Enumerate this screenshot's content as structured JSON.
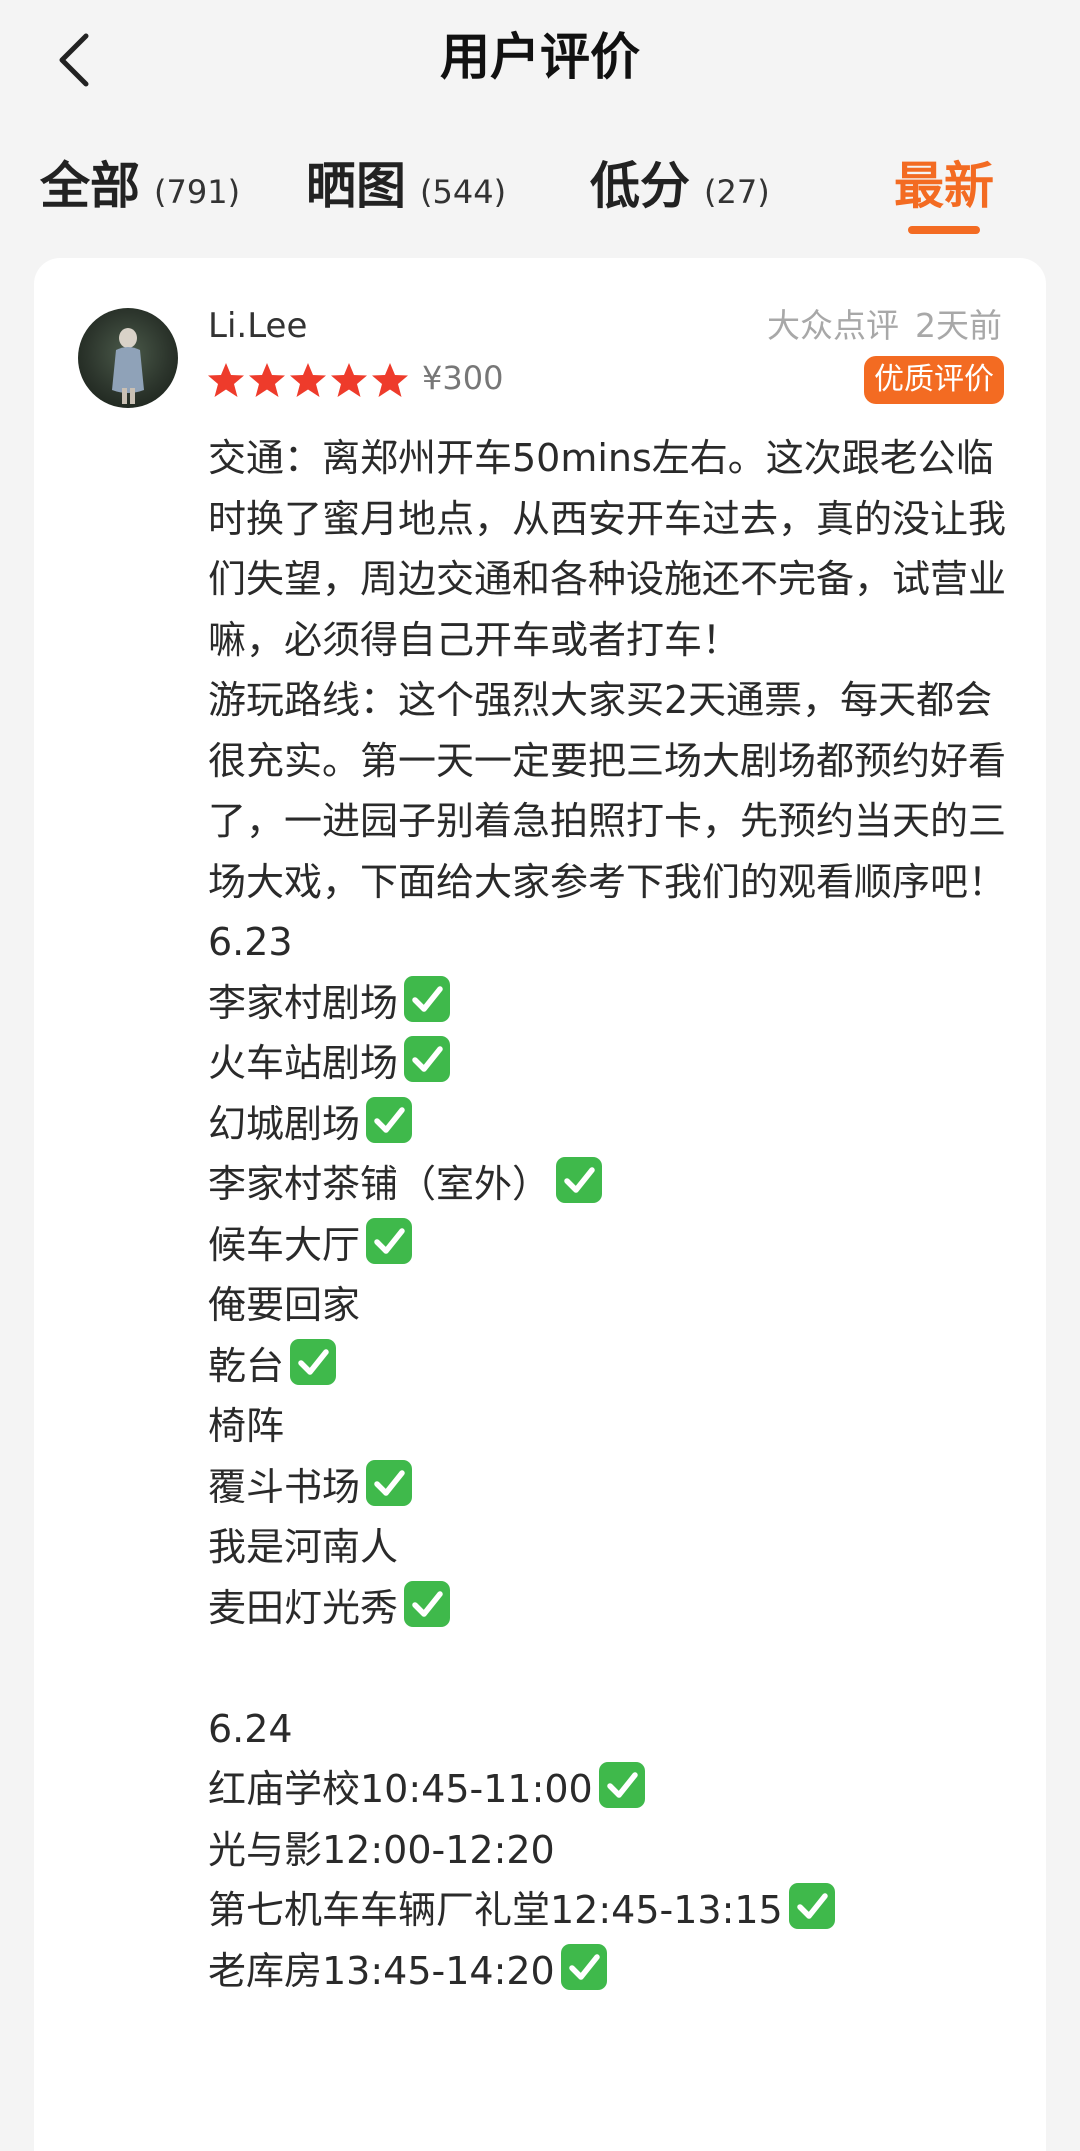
{
  "header": {
    "title": "用户评价",
    "back_icon": "chevron-left-icon"
  },
  "tabs": [
    {
      "label": "全部",
      "count": "(791)",
      "active": false
    },
    {
      "label": "晒图",
      "count": "(544)",
      "active": false
    },
    {
      "label": "低分",
      "count": "(27)",
      "active": false
    },
    {
      "label": "最新",
      "count": "",
      "active": true
    }
  ],
  "colors": {
    "accent": "#f36b22",
    "star": "#ee3b2b",
    "check": "#3fb94b"
  },
  "review": {
    "username": "Li.Lee",
    "source": "大众点评",
    "time": "2天前",
    "rating": 5,
    "price": "¥300",
    "badge": "优质评价",
    "intro_paragraphs": [
      "交通：离郑州开车50mins左右。这次跟老公临时换了蜜月地点，从西安开车过去，真的没让我们失望，周边交通和各种设施还不完备，试营业嘛，必须得自己开车或者打车！",
      "游玩路线：这个强烈大家买2天通票，每天都会很充实。第一天一定要把三场大剧场都预约好看了，一进园子别着急拍照打卡，先预约当天的三场大戏，下面给大家参考下我们的观看顺序吧！"
    ],
    "day1": {
      "date": "6.23",
      "items": [
        {
          "text": "李家村剧场",
          "checked": true
        },
        {
          "text": "火车站剧场",
          "checked": true
        },
        {
          "text": "幻城剧场",
          "checked": true
        },
        {
          "text": "李家村茶铺（室外）",
          "checked": true
        },
        {
          "text": "候车大厅",
          "checked": true
        },
        {
          "text": "俺要回家",
          "checked": false
        },
        {
          "text": "乾台",
          "checked": true
        },
        {
          "text": "椅阵",
          "checked": false
        },
        {
          "text": "覆斗书场",
          "checked": true
        },
        {
          "text": "我是河南人",
          "checked": false
        },
        {
          "text": "麦田灯光秀",
          "checked": true
        }
      ]
    },
    "day2": {
      "date": "6.24",
      "items": [
        {
          "text": "红庙学校10:45-11:00",
          "checked": true
        },
        {
          "text": "光与影12:00-12:20",
          "checked": false
        },
        {
          "text": "第七机车车辆厂礼堂12:45-13:15",
          "checked": true
        },
        {
          "text": "老库房13:45-14:20",
          "checked": true
        }
      ]
    }
  }
}
